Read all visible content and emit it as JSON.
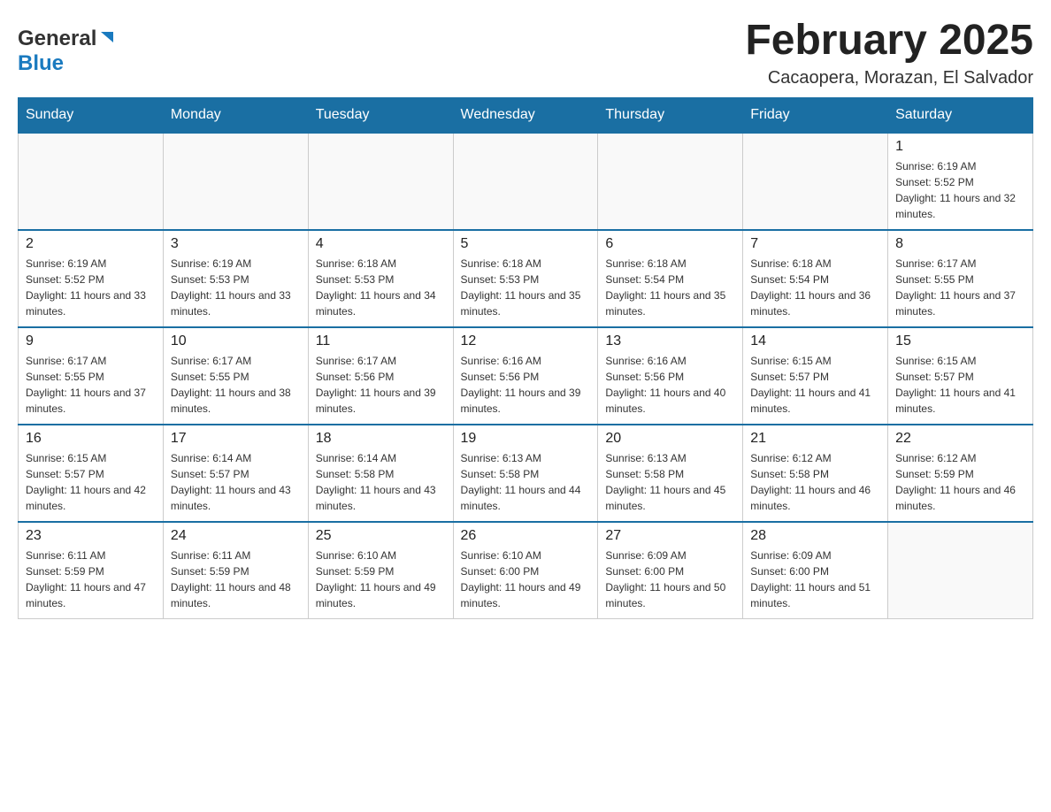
{
  "header": {
    "logo_general": "General",
    "logo_blue": "Blue",
    "month_title": "February 2025",
    "location": "Cacaopera, Morazan, El Salvador"
  },
  "days_of_week": [
    "Sunday",
    "Monday",
    "Tuesday",
    "Wednesday",
    "Thursday",
    "Friday",
    "Saturday"
  ],
  "weeks": [
    [
      {
        "day": "",
        "info": ""
      },
      {
        "day": "",
        "info": ""
      },
      {
        "day": "",
        "info": ""
      },
      {
        "day": "",
        "info": ""
      },
      {
        "day": "",
        "info": ""
      },
      {
        "day": "",
        "info": ""
      },
      {
        "day": "1",
        "info": "Sunrise: 6:19 AM\nSunset: 5:52 PM\nDaylight: 11 hours and 32 minutes."
      }
    ],
    [
      {
        "day": "2",
        "info": "Sunrise: 6:19 AM\nSunset: 5:52 PM\nDaylight: 11 hours and 33 minutes."
      },
      {
        "day": "3",
        "info": "Sunrise: 6:19 AM\nSunset: 5:53 PM\nDaylight: 11 hours and 33 minutes."
      },
      {
        "day": "4",
        "info": "Sunrise: 6:18 AM\nSunset: 5:53 PM\nDaylight: 11 hours and 34 minutes."
      },
      {
        "day": "5",
        "info": "Sunrise: 6:18 AM\nSunset: 5:53 PM\nDaylight: 11 hours and 35 minutes."
      },
      {
        "day": "6",
        "info": "Sunrise: 6:18 AM\nSunset: 5:54 PM\nDaylight: 11 hours and 35 minutes."
      },
      {
        "day": "7",
        "info": "Sunrise: 6:18 AM\nSunset: 5:54 PM\nDaylight: 11 hours and 36 minutes."
      },
      {
        "day": "8",
        "info": "Sunrise: 6:17 AM\nSunset: 5:55 PM\nDaylight: 11 hours and 37 minutes."
      }
    ],
    [
      {
        "day": "9",
        "info": "Sunrise: 6:17 AM\nSunset: 5:55 PM\nDaylight: 11 hours and 37 minutes."
      },
      {
        "day": "10",
        "info": "Sunrise: 6:17 AM\nSunset: 5:55 PM\nDaylight: 11 hours and 38 minutes."
      },
      {
        "day": "11",
        "info": "Sunrise: 6:17 AM\nSunset: 5:56 PM\nDaylight: 11 hours and 39 minutes."
      },
      {
        "day": "12",
        "info": "Sunrise: 6:16 AM\nSunset: 5:56 PM\nDaylight: 11 hours and 39 minutes."
      },
      {
        "day": "13",
        "info": "Sunrise: 6:16 AM\nSunset: 5:56 PM\nDaylight: 11 hours and 40 minutes."
      },
      {
        "day": "14",
        "info": "Sunrise: 6:15 AM\nSunset: 5:57 PM\nDaylight: 11 hours and 41 minutes."
      },
      {
        "day": "15",
        "info": "Sunrise: 6:15 AM\nSunset: 5:57 PM\nDaylight: 11 hours and 41 minutes."
      }
    ],
    [
      {
        "day": "16",
        "info": "Sunrise: 6:15 AM\nSunset: 5:57 PM\nDaylight: 11 hours and 42 minutes."
      },
      {
        "day": "17",
        "info": "Sunrise: 6:14 AM\nSunset: 5:57 PM\nDaylight: 11 hours and 43 minutes."
      },
      {
        "day": "18",
        "info": "Sunrise: 6:14 AM\nSunset: 5:58 PM\nDaylight: 11 hours and 43 minutes."
      },
      {
        "day": "19",
        "info": "Sunrise: 6:13 AM\nSunset: 5:58 PM\nDaylight: 11 hours and 44 minutes."
      },
      {
        "day": "20",
        "info": "Sunrise: 6:13 AM\nSunset: 5:58 PM\nDaylight: 11 hours and 45 minutes."
      },
      {
        "day": "21",
        "info": "Sunrise: 6:12 AM\nSunset: 5:58 PM\nDaylight: 11 hours and 46 minutes."
      },
      {
        "day": "22",
        "info": "Sunrise: 6:12 AM\nSunset: 5:59 PM\nDaylight: 11 hours and 46 minutes."
      }
    ],
    [
      {
        "day": "23",
        "info": "Sunrise: 6:11 AM\nSunset: 5:59 PM\nDaylight: 11 hours and 47 minutes."
      },
      {
        "day": "24",
        "info": "Sunrise: 6:11 AM\nSunset: 5:59 PM\nDaylight: 11 hours and 48 minutes."
      },
      {
        "day": "25",
        "info": "Sunrise: 6:10 AM\nSunset: 5:59 PM\nDaylight: 11 hours and 49 minutes."
      },
      {
        "day": "26",
        "info": "Sunrise: 6:10 AM\nSunset: 6:00 PM\nDaylight: 11 hours and 49 minutes."
      },
      {
        "day": "27",
        "info": "Sunrise: 6:09 AM\nSunset: 6:00 PM\nDaylight: 11 hours and 50 minutes."
      },
      {
        "day": "28",
        "info": "Sunrise: 6:09 AM\nSunset: 6:00 PM\nDaylight: 11 hours and 51 minutes."
      },
      {
        "day": "",
        "info": ""
      }
    ]
  ]
}
